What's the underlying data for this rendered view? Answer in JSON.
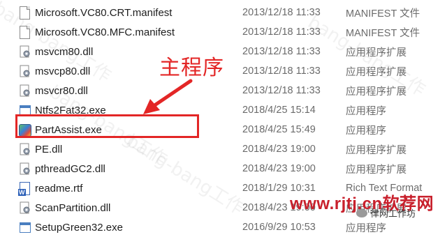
{
  "files": [
    {
      "name": "Microsoft.VC80.CRT.manifest",
      "date": "2013/12/18 11:33",
      "type": "MANIFEST 文件",
      "icon": "document-icon"
    },
    {
      "name": "Microsoft.VC80.MFC.manifest",
      "date": "2013/12/18 11:33",
      "type": "MANIFEST 文件",
      "icon": "document-icon"
    },
    {
      "name": "msvcm80.dll",
      "date": "2013/12/18 11:33",
      "type": "应用程序扩展",
      "icon": "dll-gear-icon"
    },
    {
      "name": "msvcp80.dll",
      "date": "2013/12/18 11:33",
      "type": "应用程序扩展",
      "icon": "dll-gear-icon"
    },
    {
      "name": "msvcr80.dll",
      "date": "2013/12/18 11:33",
      "type": "应用程序扩展",
      "icon": "dll-gear-icon"
    },
    {
      "name": "Ntfs2Fat32.exe",
      "date": "2018/4/25 15:14",
      "type": "应用程序",
      "icon": "exe-icon"
    },
    {
      "name": "PartAssist.exe",
      "date": "2018/4/25 15:49",
      "type": "应用程序",
      "icon": "partassist-app-icon"
    },
    {
      "name": "PE.dll",
      "date": "2018/4/23 19:00",
      "type": "应用程序扩展",
      "icon": "dll-gear-icon"
    },
    {
      "name": "pthreadGC2.dll",
      "date": "2018/4/23 19:00",
      "type": "应用程序扩展",
      "icon": "dll-gear-icon"
    },
    {
      "name": "readme.rtf",
      "date": "2018/1/29 10:31",
      "type": "Rich Text Format",
      "icon": "rtf-document-icon"
    },
    {
      "name": "ScanPartition.dll",
      "date": "2018/4/23 19:00",
      "type": "应用程序扩展",
      "icon": "dll-gear-icon"
    },
    {
      "name": "SetupGreen32.exe",
      "date": "2016/9/29 10:53",
      "type": "应用程序",
      "icon": "window-exe-icon"
    }
  ],
  "annotation": {
    "label": "主程序",
    "color": "#e32626"
  },
  "watermark": {
    "brand": "www.rjtj.cn软荐网",
    "wechat": "律网工作坊",
    "diagonal": "bang-bang工作"
  }
}
